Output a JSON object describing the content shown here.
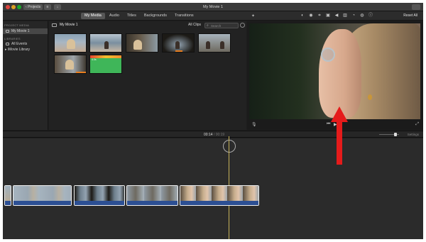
{
  "window": {
    "title": "My Movie 1",
    "projects_button": "Projects"
  },
  "topbar": {
    "tabs": [
      {
        "label": "My Media",
        "active": true
      },
      {
        "label": "Audio",
        "active": false
      },
      {
        "label": "Titles",
        "active": false
      },
      {
        "label": "Backgrounds",
        "active": false
      },
      {
        "label": "Transitions",
        "active": false
      }
    ],
    "tool_icons": [
      "color-balance-icon",
      "color-correction-icon",
      "crop-icon",
      "stabilization-icon",
      "volume-icon",
      "noise-reduction-icon",
      "speed-icon",
      "filter-icon",
      "info-icon"
    ],
    "reset_all": "Reset All"
  },
  "sidebar": {
    "project_media_heading": "PROJECT MEDIA",
    "project_item": "My Movie 1",
    "libraries_heading": "LIBRARIES",
    "all_events": "All Events",
    "imovie_library": "iMovie Library"
  },
  "browser": {
    "title": "My Movie 1",
    "all_clips": "All Clips",
    "search_placeholder": "Search",
    "thumbnail_count": 7,
    "title_clip_duration": "4.0s"
  },
  "timeline": {
    "current_time": "00:14",
    "total_time": "00:19",
    "settings_label": "Settings",
    "clip_count": 5
  },
  "annotation": {
    "arrow_color": "#e51b1b"
  },
  "colors": {
    "accent_tab": "#565656",
    "audio_track": "#2c4f93",
    "playhead": "#c7b35a"
  }
}
